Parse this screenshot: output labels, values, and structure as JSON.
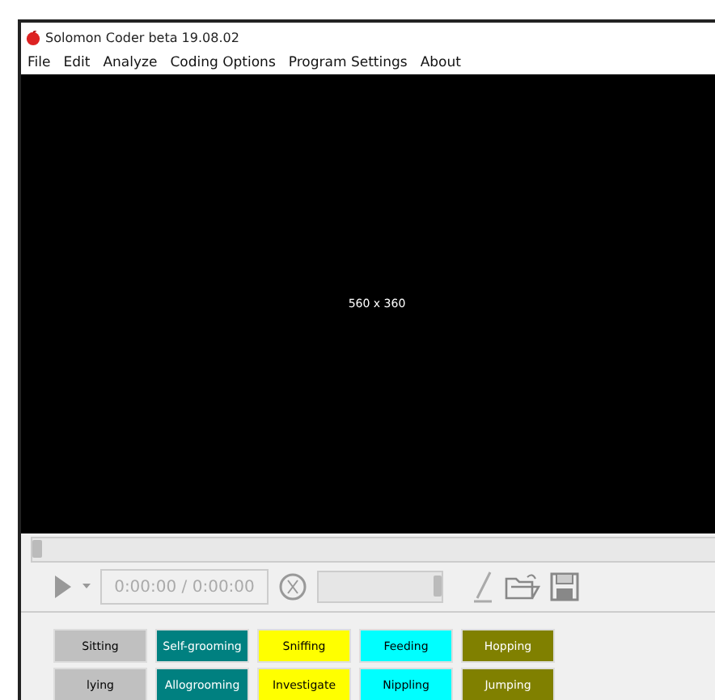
{
  "window": {
    "title": "Solomon Coder beta 19.08.02"
  },
  "menu": [
    "File",
    "Edit",
    "Analyze",
    "Coding Options",
    "Program Settings",
    "About"
  ],
  "video": {
    "label": "560 x 360"
  },
  "seek": {
    "level": 0
  },
  "toolbar": {
    "time": "0:00:00 / 0:00:00",
    "volume": {
      "level": 1
    }
  },
  "behaviors": [
    [
      {
        "label": "Sitting",
        "color": "#c0c0c0"
      },
      {
        "label": "Self-grooming",
        "color": "#008080"
      },
      {
        "label": "Sniffing",
        "color": "#ffff00"
      },
      {
        "label": "Feeding",
        "color": "#00ffff"
      },
      {
        "label": "Hopping",
        "color": "#808000"
      }
    ],
    [
      {
        "label": "lying",
        "color": "#c0c0c0"
      },
      {
        "label": "Allogrooming",
        "color": "#008080"
      },
      {
        "label": "Investigate",
        "color": "#ffff00"
      },
      {
        "label": "Nippling",
        "color": "#00ffff"
      },
      {
        "label": "Jumping",
        "color": "#808000"
      }
    ]
  ]
}
